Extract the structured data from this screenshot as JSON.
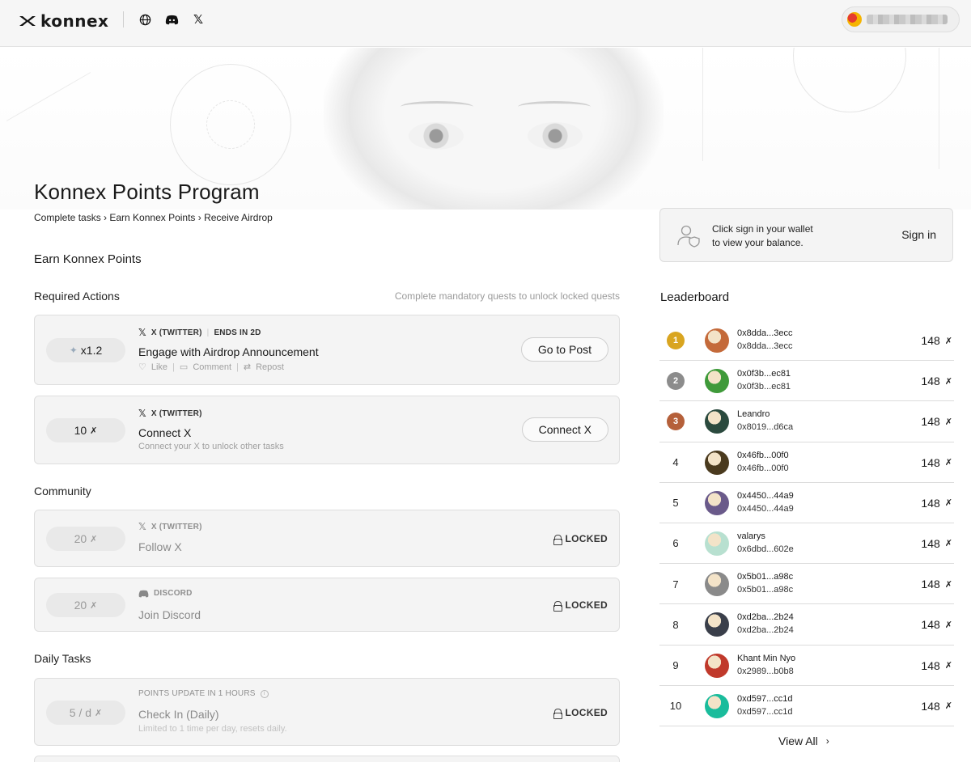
{
  "topbar": {
    "brand": "konnex",
    "icons": [
      "globe-icon",
      "discord-icon",
      "x-icon"
    ],
    "wallet_address": "0x······"
  },
  "page": {
    "title": "Konnex Points Program",
    "breadcrumb": "Complete tasks › Earn Konnex Points › Receive Airdrop",
    "earn_heading": "Earn Konnex Points"
  },
  "required": {
    "heading": "Required Actions",
    "hint": "Complete mandatory quests to unlock locked quests",
    "tasks": [
      {
        "reward": "x1.2",
        "platform": "X (TWITTER)",
        "ends": "ENDS IN 2D",
        "title": "Engage with Airdrop Announcement",
        "actions": [
          "Like",
          "Comment",
          "Repost"
        ],
        "button": "Go to Post"
      },
      {
        "reward": "10",
        "platform": "X (TWITTER)",
        "title": "Connect X",
        "subtitle": "Connect your X to unlock other tasks",
        "button": "Connect X"
      }
    ]
  },
  "community": {
    "heading": "Community",
    "tasks": [
      {
        "reward": "20",
        "platform": "X (TWITTER)",
        "title": "Follow X",
        "status": "LOCKED"
      },
      {
        "reward": "20",
        "platform": "DISCORD",
        "title": "Join Discord",
        "status": "LOCKED"
      }
    ]
  },
  "daily": {
    "heading": "Daily Tasks",
    "tasks": [
      {
        "reward": "5 / d",
        "meta": "POINTS UPDATE IN 1 HOURS",
        "title": "Check In (Daily)",
        "subtitle": "Limited to 1 time per day, resets daily.",
        "status": "LOCKED"
      }
    ]
  },
  "signin": {
    "line1": "Click sign in your wallet",
    "line2": "to view your balance.",
    "button": "Sign in"
  },
  "leaderboard": {
    "title": "Leaderboard",
    "rows": [
      {
        "rank": "1",
        "name": "0x8dda...3ecc",
        "address": "0x8dda...3ecc",
        "score": "148",
        "avatar_color": "#c46a3a"
      },
      {
        "rank": "2",
        "name": "0x0f3b...ec81",
        "address": "0x0f3b...ec81",
        "score": "148",
        "avatar_color": "#3f9a3a"
      },
      {
        "rank": "3",
        "name": "Leandro",
        "address": "0x8019...d6ca",
        "score": "148",
        "avatar_color": "#2b4a3e"
      },
      {
        "rank": "4",
        "name": "0x46fb...00f0",
        "address": "0x46fb...00f0",
        "score": "148",
        "avatar_color": "#4a3a1e"
      },
      {
        "rank": "5",
        "name": "0x4450...44a9",
        "address": "0x4450...44a9",
        "score": "148",
        "avatar_color": "#6a5a8a"
      },
      {
        "rank": "6",
        "name": "valarys",
        "address": "0x6dbd...602e",
        "score": "148",
        "avatar_color": "#b8e0d0"
      },
      {
        "rank": "7",
        "name": "0x5b01...a98c",
        "address": "0x5b01...a98c",
        "score": "148",
        "avatar_color": "#8a8a8a"
      },
      {
        "rank": "8",
        "name": "0xd2ba...2b24",
        "address": "0xd2ba...2b24",
        "score": "148",
        "avatar_color": "#3a3f4a"
      },
      {
        "rank": "9",
        "name": "Khant Min Nyo",
        "address": "0x2989...b0b8",
        "score": "148",
        "avatar_color": "#c0392b"
      },
      {
        "rank": "10",
        "name": "0xd597...cc1d",
        "address": "0xd597...cc1d",
        "score": "148",
        "avatar_color": "#1abc9c"
      }
    ],
    "view_all": "View All"
  },
  "colors": {
    "gold": "#d9a520",
    "silver": "#8c8c8c",
    "bronze": "#b5603a",
    "card_bg": "#f4f4f4",
    "border": "#dedede"
  }
}
